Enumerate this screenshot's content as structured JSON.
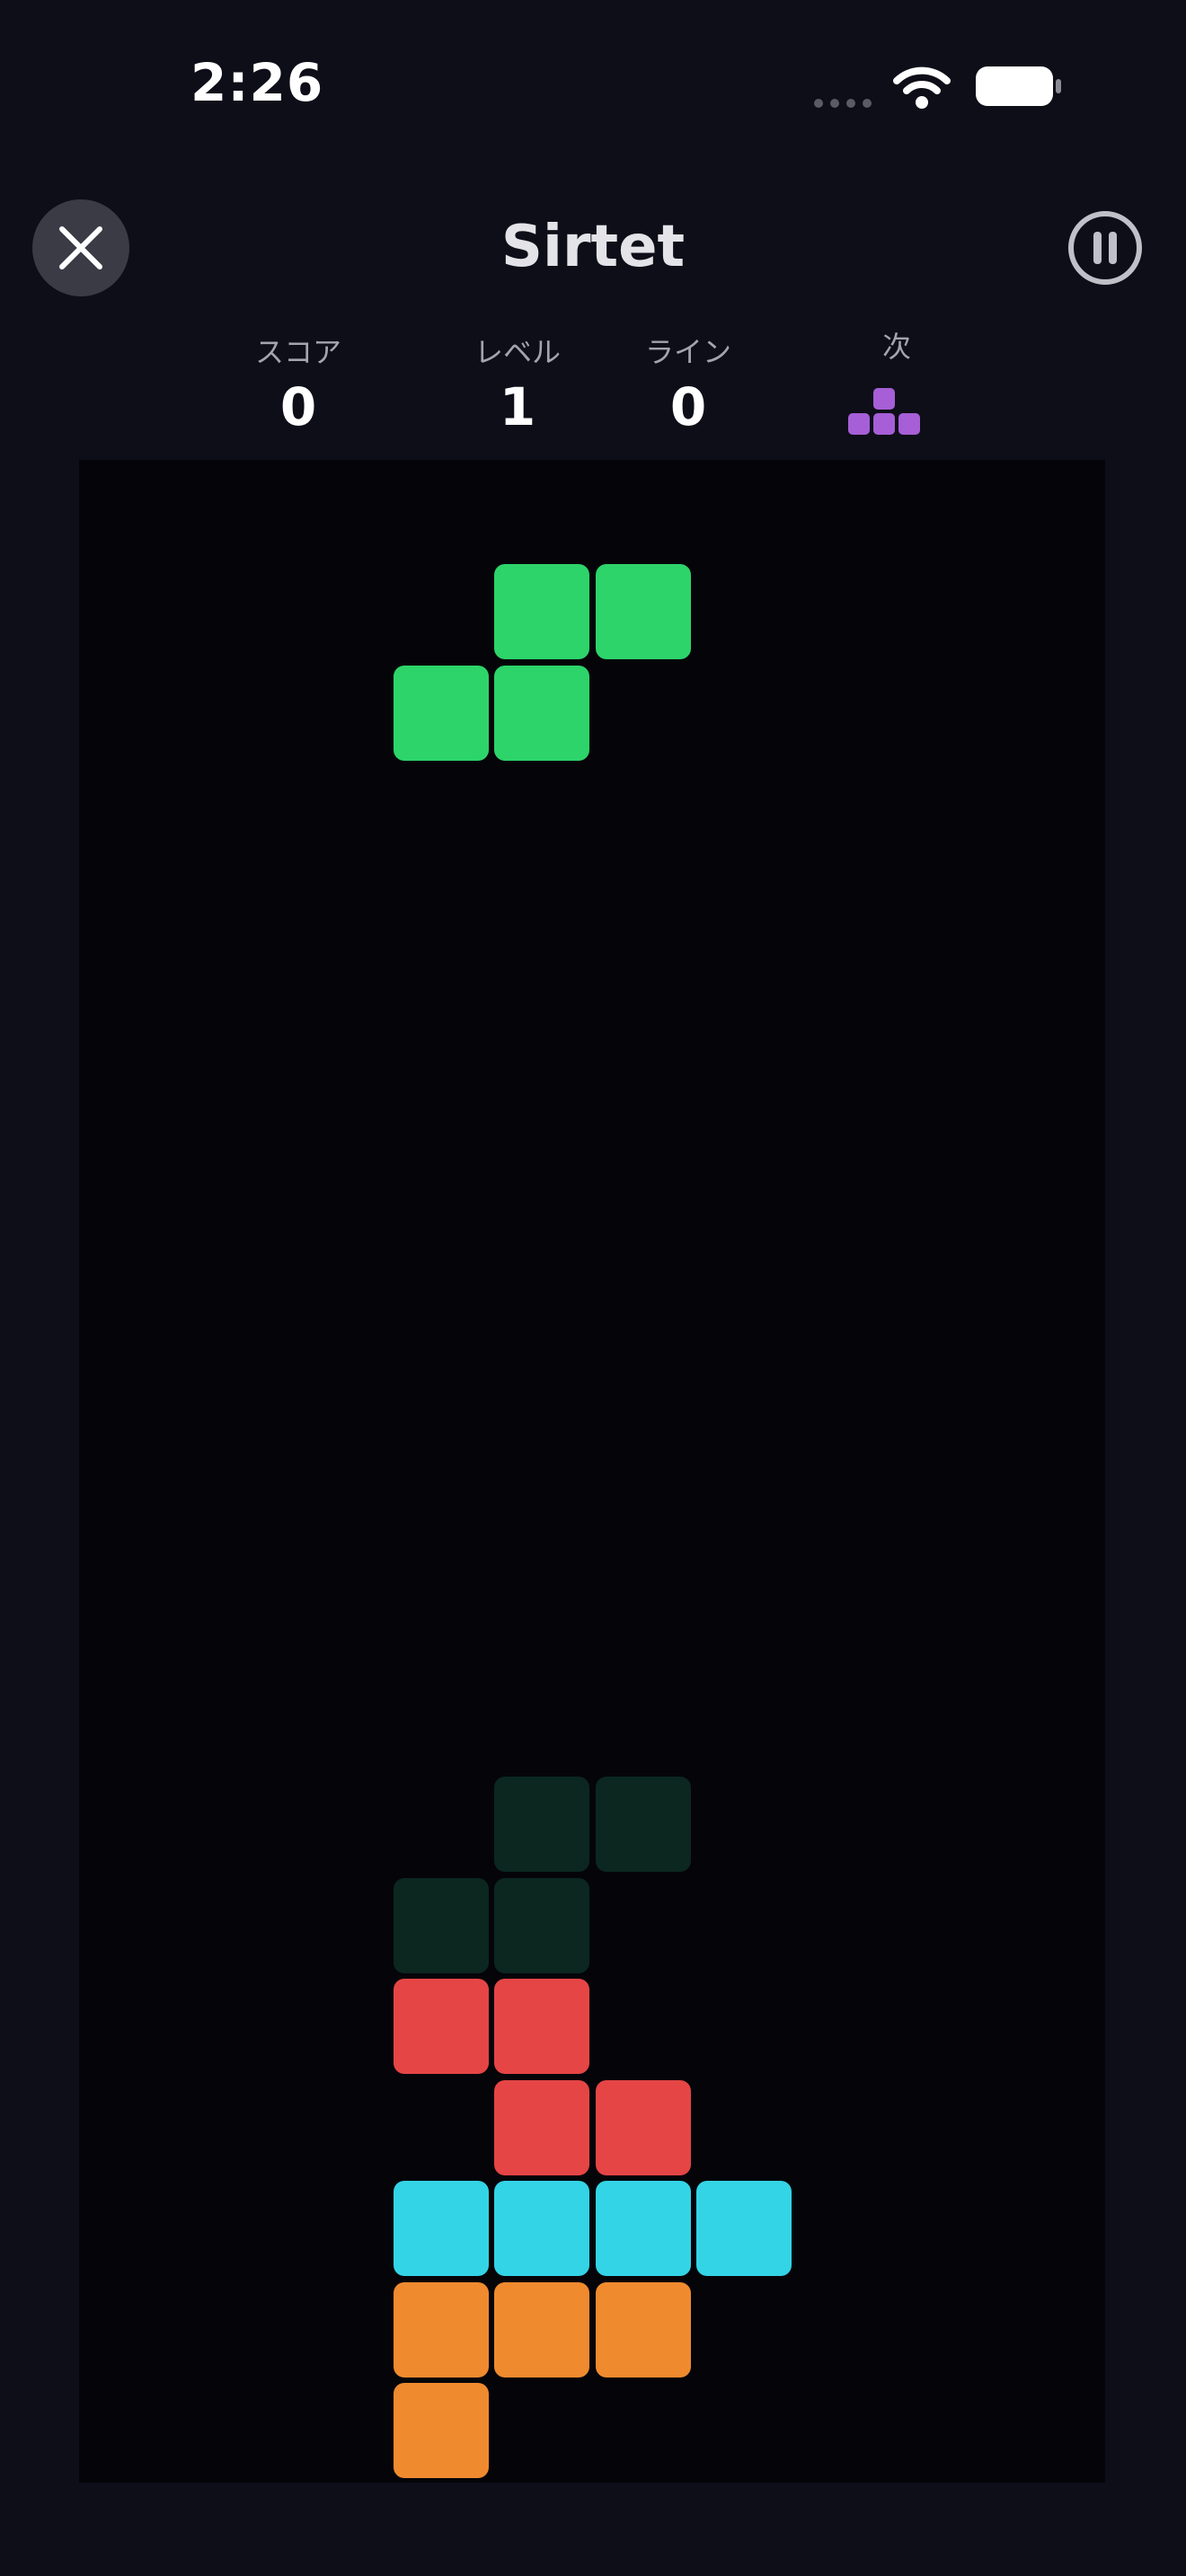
{
  "status_bar": {
    "time": "2:26"
  },
  "header": {
    "title": "Sirtet",
    "close_icon": "close-x-icon",
    "pause_icon": "pause-circle-icon"
  },
  "stats": {
    "score": {
      "label": "スコア",
      "value": "0"
    },
    "level": {
      "label": "レベル",
      "value": "1"
    },
    "lines": {
      "label": "ライン",
      "value": "0"
    },
    "next": {
      "label": "次",
      "piece": "T",
      "color": "#a65fd6"
    }
  },
  "colors": {
    "background": "#0d0e18",
    "board": "#050509",
    "S": "#2dd46a",
    "ghost": "#0b2720",
    "Z": "#e54545",
    "I": "#33d4e6",
    "L": "#ef8a2e",
    "T": "#a65fd6"
  },
  "board": {
    "columns": 10,
    "rows": 20,
    "active_piece": {
      "type": "S",
      "cells": [
        [
          4,
          1
        ],
        [
          5,
          1
        ],
        [
          3,
          2
        ],
        [
          4,
          2
        ]
      ]
    },
    "ghost_piece": {
      "type": "S",
      "cells": [
        [
          4,
          13
        ],
        [
          5,
          13
        ],
        [
          3,
          14
        ],
        [
          4,
          14
        ]
      ]
    },
    "locked_cells": [
      {
        "type": "Z",
        "col": 3,
        "row": 15
      },
      {
        "type": "Z",
        "col": 4,
        "row": 15
      },
      {
        "type": "Z",
        "col": 4,
        "row": 16
      },
      {
        "type": "Z",
        "col": 5,
        "row": 16
      },
      {
        "type": "I",
        "col": 3,
        "row": 17
      },
      {
        "type": "I",
        "col": 4,
        "row": 17
      },
      {
        "type": "I",
        "col": 5,
        "row": 17
      },
      {
        "type": "I",
        "col": 6,
        "row": 17
      },
      {
        "type": "L",
        "col": 3,
        "row": 18
      },
      {
        "type": "L",
        "col": 4,
        "row": 18
      },
      {
        "type": "L",
        "col": 5,
        "row": 18
      },
      {
        "type": "L",
        "col": 3,
        "row": 19
      }
    ]
  }
}
